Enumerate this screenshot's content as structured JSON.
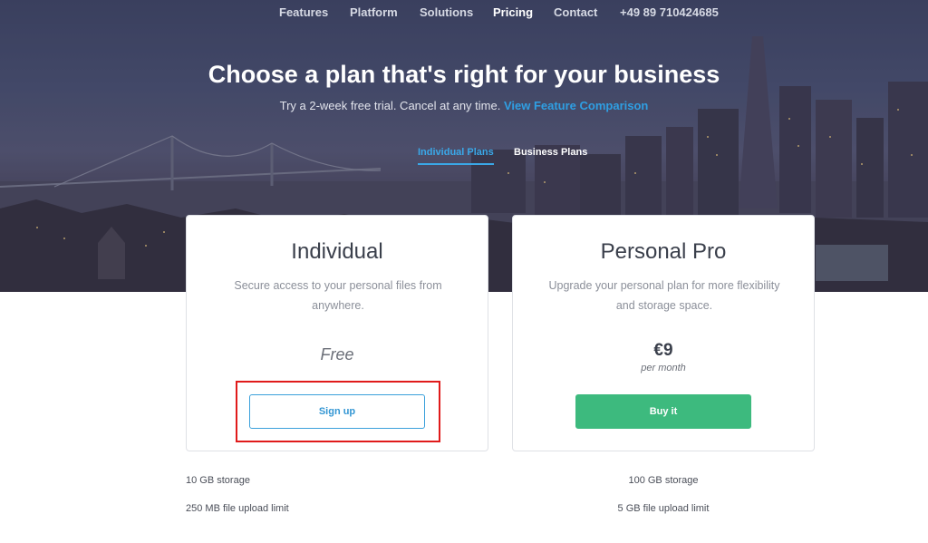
{
  "nav": {
    "features": "Features",
    "platform": "Platform",
    "solutions": "Solutions",
    "pricing": "Pricing",
    "contact": "Contact",
    "phone": "+49 89 710424685"
  },
  "hero": {
    "title": "Choose a plan that's right for your business",
    "subtitle": "Try a 2-week free trial. Cancel at any time.",
    "comparison_link": "View Feature Comparison"
  },
  "plan_tabs": {
    "individual": "Individual Plans",
    "business": "Business Plans",
    "active": "individual"
  },
  "plans": [
    {
      "name": "Individual",
      "description": "Secure access to your personal files from anywhere.",
      "price": "Free",
      "button": "Sign up",
      "features": [
        "10 GB storage",
        "250 MB file upload limit"
      ]
    },
    {
      "name": "Personal Pro",
      "description": "Upgrade your personal plan for more flexibility and storage space.",
      "price": "€9",
      "price_period": "per month",
      "button": "Buy it",
      "features": [
        "100 GB storage",
        "5 GB file upload limit"
      ]
    }
  ],
  "colors": {
    "accent_blue": "#3aa8e8",
    "buy_green": "#3dba7e",
    "highlight_red": "#e01b1b"
  }
}
